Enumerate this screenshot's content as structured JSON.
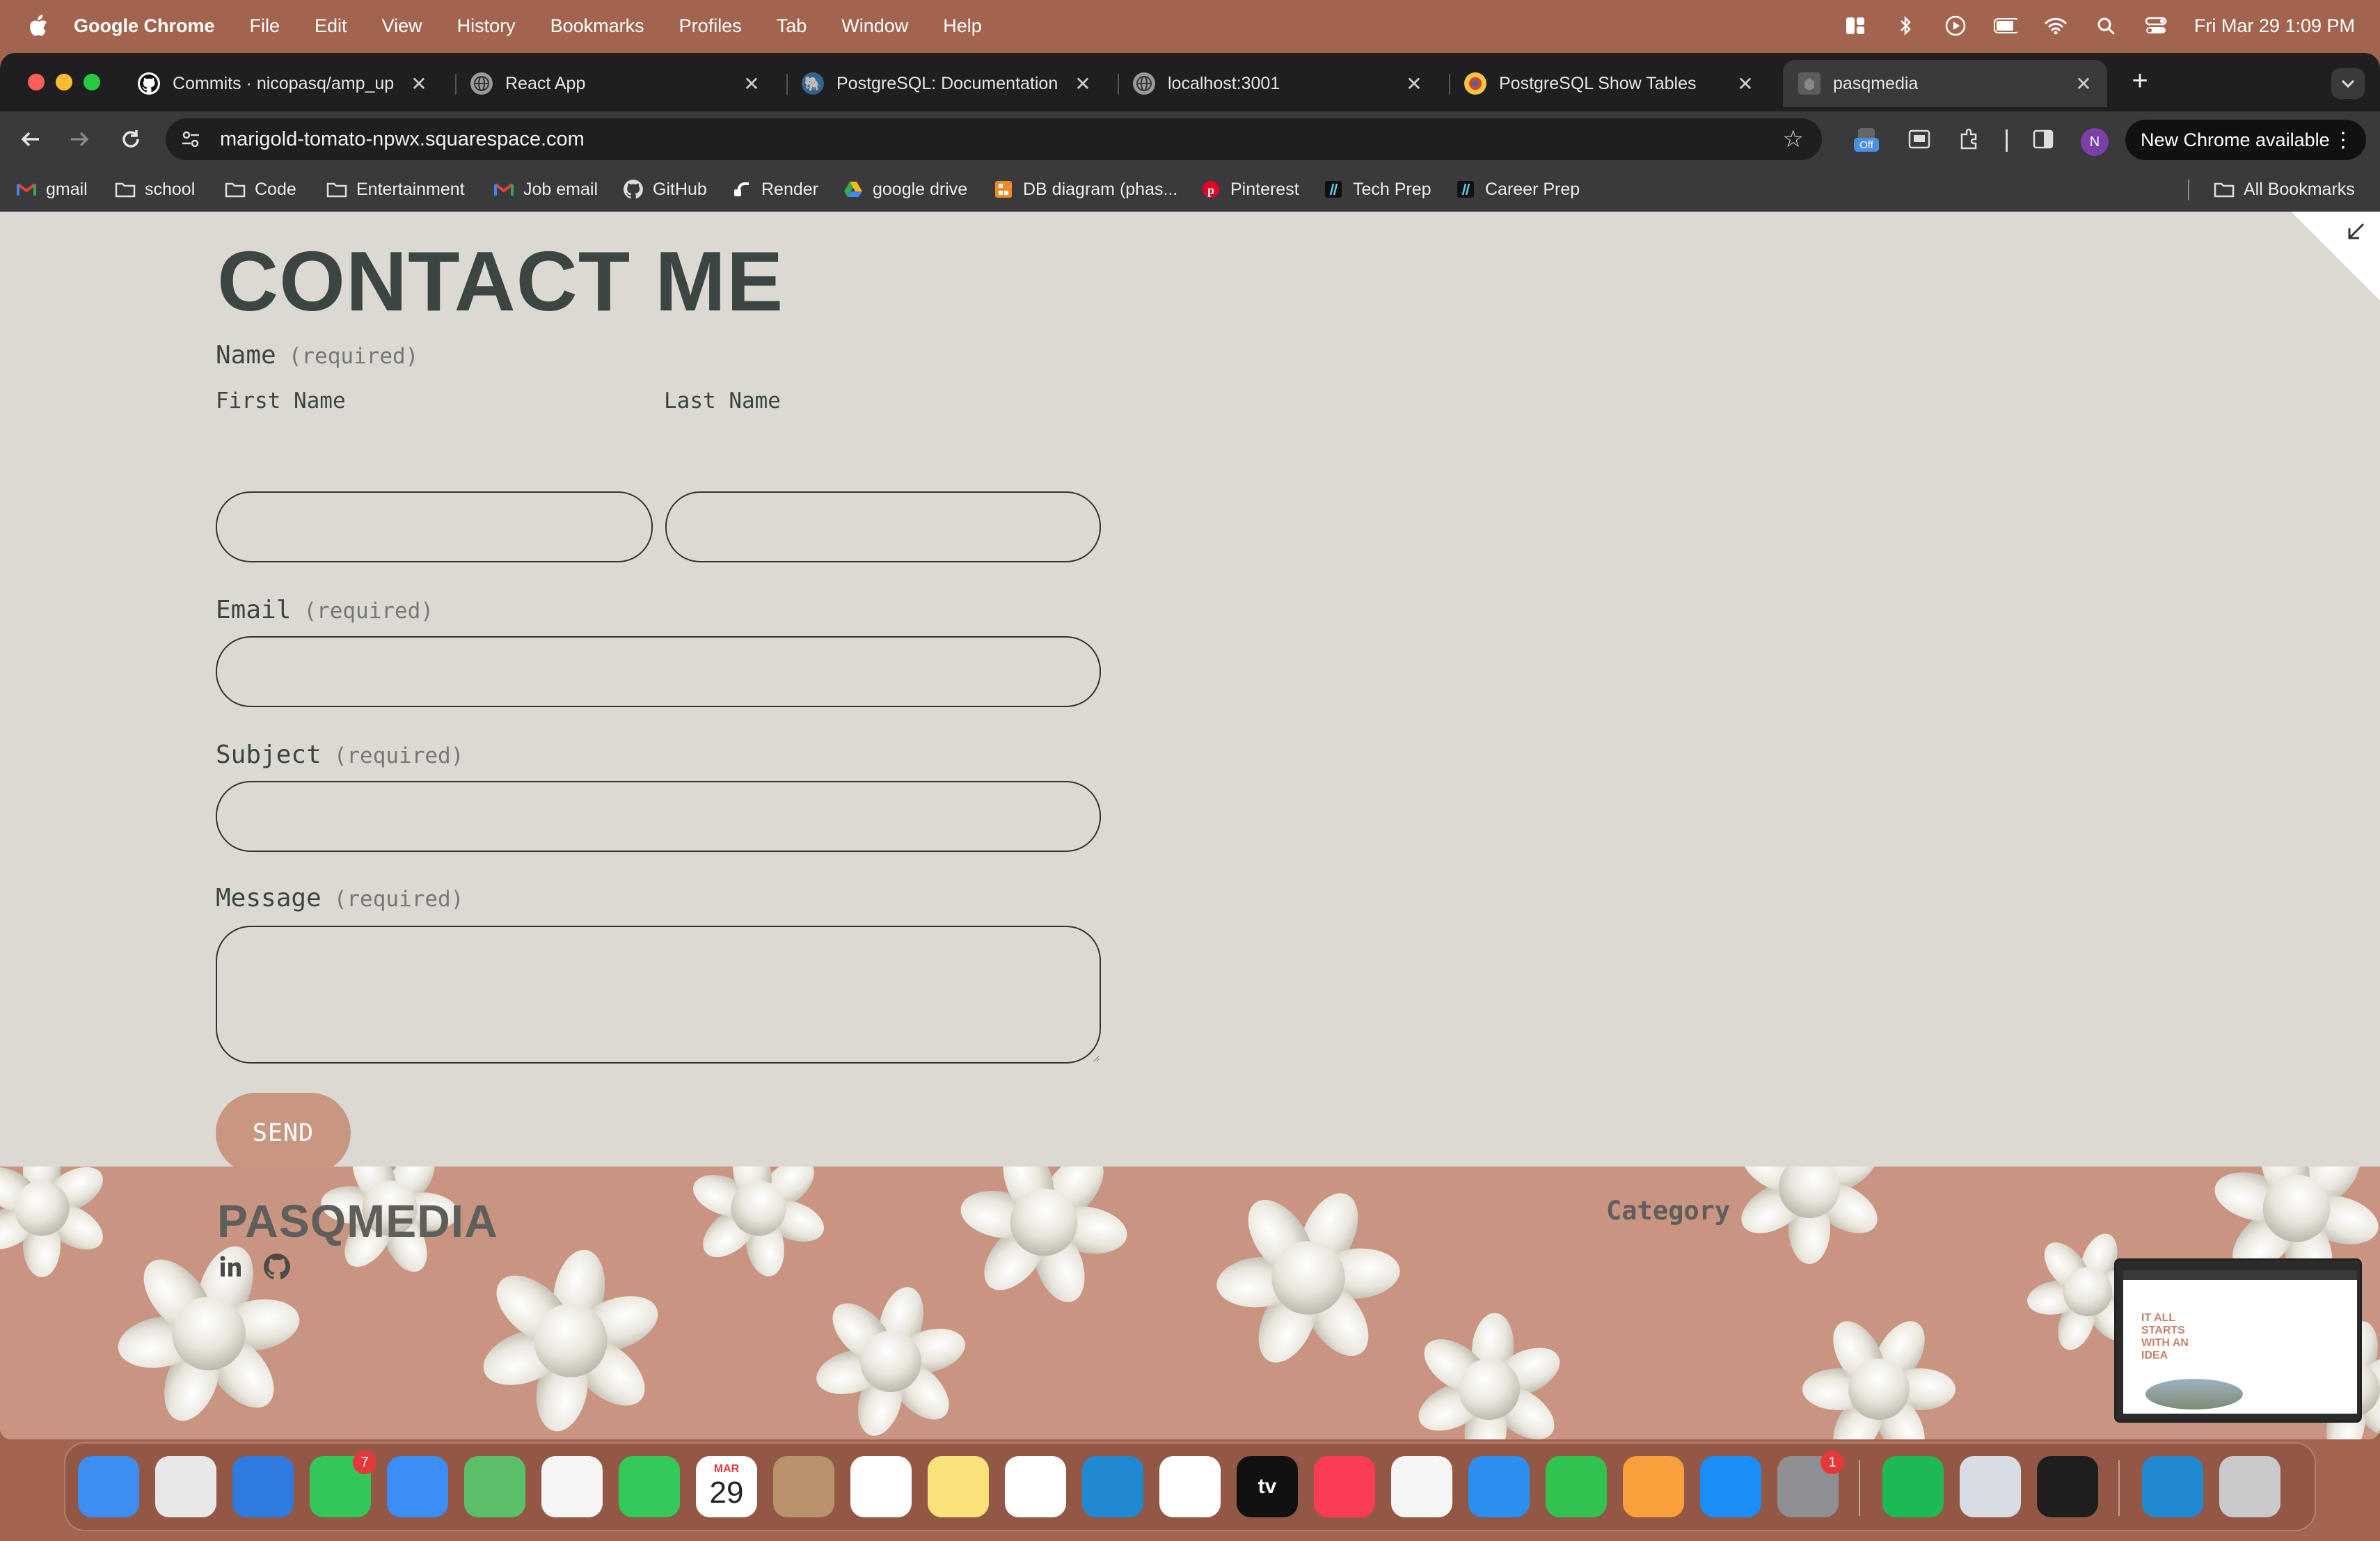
{
  "menubar": {
    "app_name": "Google Chrome",
    "items": [
      "File",
      "Edit",
      "View",
      "History",
      "Bookmarks",
      "Profiles",
      "Tab",
      "Window",
      "Help"
    ],
    "clock": "Fri Mar 29  1:09 PM"
  },
  "tabs": [
    {
      "title": "Commits · nicopasq/amp_up",
      "icon": "github-icon"
    },
    {
      "title": "React App",
      "icon": "globe-icon"
    },
    {
      "title": "PostgreSQL: Documentation",
      "icon": "postgres-icon"
    },
    {
      "title": "localhost:3001",
      "icon": "globe-icon"
    },
    {
      "title": "PostgreSQL Show Tables",
      "icon": "site-icon"
    },
    {
      "title": "pasqmedia",
      "icon": "squarespace-icon",
      "active": true
    }
  ],
  "toolbar": {
    "url": "marigold-tomato-npwx.squarespace.com",
    "extension_badge": "Off",
    "profile_initial": "N",
    "update_label": "New Chrome available"
  },
  "bookmarks": [
    {
      "label": "gmail",
      "icon": "gmail-icon"
    },
    {
      "label": "school",
      "icon": "folder-icon"
    },
    {
      "label": "Code",
      "icon": "folder-icon"
    },
    {
      "label": "Entertainment",
      "icon": "folder-icon"
    },
    {
      "label": "Job email",
      "icon": "gmail-icon"
    },
    {
      "label": "GitHub",
      "icon": "github-icon"
    },
    {
      "label": "Render",
      "icon": "render-icon"
    },
    {
      "label": "google drive",
      "icon": "drive-icon"
    },
    {
      "label": "DB diagram (phas...",
      "icon": "dbdiagram-icon"
    },
    {
      "label": "Pinterest",
      "icon": "pinterest-icon"
    },
    {
      "label": "Tech Prep",
      "icon": "techprep-icon"
    },
    {
      "label": "Career Prep",
      "icon": "techprep-icon"
    }
  ],
  "all_bookmarks": "All Bookmarks",
  "form": {
    "title": "CONTACT ME",
    "name_label": "Name",
    "required_text": "(required)",
    "first_name_label": "First Name",
    "last_name_label": "Last Name",
    "email_label": "Email",
    "subject_label": "Subject",
    "message_label": "Message",
    "first_name_value": "",
    "last_name_value": "",
    "email_value": "",
    "subject_value": "",
    "message_value": "",
    "send_label": "SEND"
  },
  "footer": {
    "brand": "PASQMEDIA",
    "category_label": "Category",
    "social": [
      "linkedin-icon",
      "github-icon"
    ]
  },
  "thumbnail": {
    "headline": "IT ALL STARTS WITH AN IDEA"
  },
  "dock": {
    "apps": [
      {
        "name": "Finder",
        "color": "#3d8ef0"
      },
      {
        "name": "Launchpad",
        "color": "#e8e8e8"
      },
      {
        "name": "Safari",
        "color": "#2f7be0"
      },
      {
        "name": "Messages",
        "color": "#33c759",
        "badge": "7"
      },
      {
        "name": "Mail",
        "color": "#3a8ef6"
      },
      {
        "name": "Maps",
        "color": "#5bbf6a"
      },
      {
        "name": "Photos",
        "color": "#f5f5f5"
      },
      {
        "name": "FaceTime",
        "color": "#34c759"
      },
      {
        "name": "Calendar",
        "color": "#ffffff",
        "month": "MAR",
        "day": "29"
      },
      {
        "name": "Contacts",
        "color": "#b7926a"
      },
      {
        "name": "Reminders",
        "color": "#ffffff"
      },
      {
        "name": "Notes",
        "color": "#fbe27a"
      },
      {
        "name": "Chrome",
        "color": "#ffffff"
      },
      {
        "name": "VS Code",
        "color": "#1f8ad2"
      },
      {
        "name": "Freeform",
        "color": "#ffffff"
      },
      {
        "name": "TV",
        "color": "#111111",
        "label": "tv"
      },
      {
        "name": "Music",
        "color": "#fa3c55"
      },
      {
        "name": "News",
        "color": "#f5f5f5"
      },
      {
        "name": "Keynote",
        "color": "#2d8ff0"
      },
      {
        "name": "Numbers",
        "color": "#31c24f"
      },
      {
        "name": "Pages",
        "color": "#f9a03c"
      },
      {
        "name": "App Store",
        "color": "#1b8ef8"
      },
      {
        "name": "System Settings",
        "color": "#8e8e93",
        "badge": "1"
      },
      {
        "name": "Spotify",
        "color": "#1db954"
      },
      {
        "name": "Preview",
        "color": "#d8dde4"
      },
      {
        "name": "Terminal",
        "color": "#1e1e1e"
      },
      {
        "name": "VS Code",
        "color": "#1f8ad2"
      },
      {
        "name": "Trash",
        "color": "#c9c9cc"
      }
    ]
  }
}
